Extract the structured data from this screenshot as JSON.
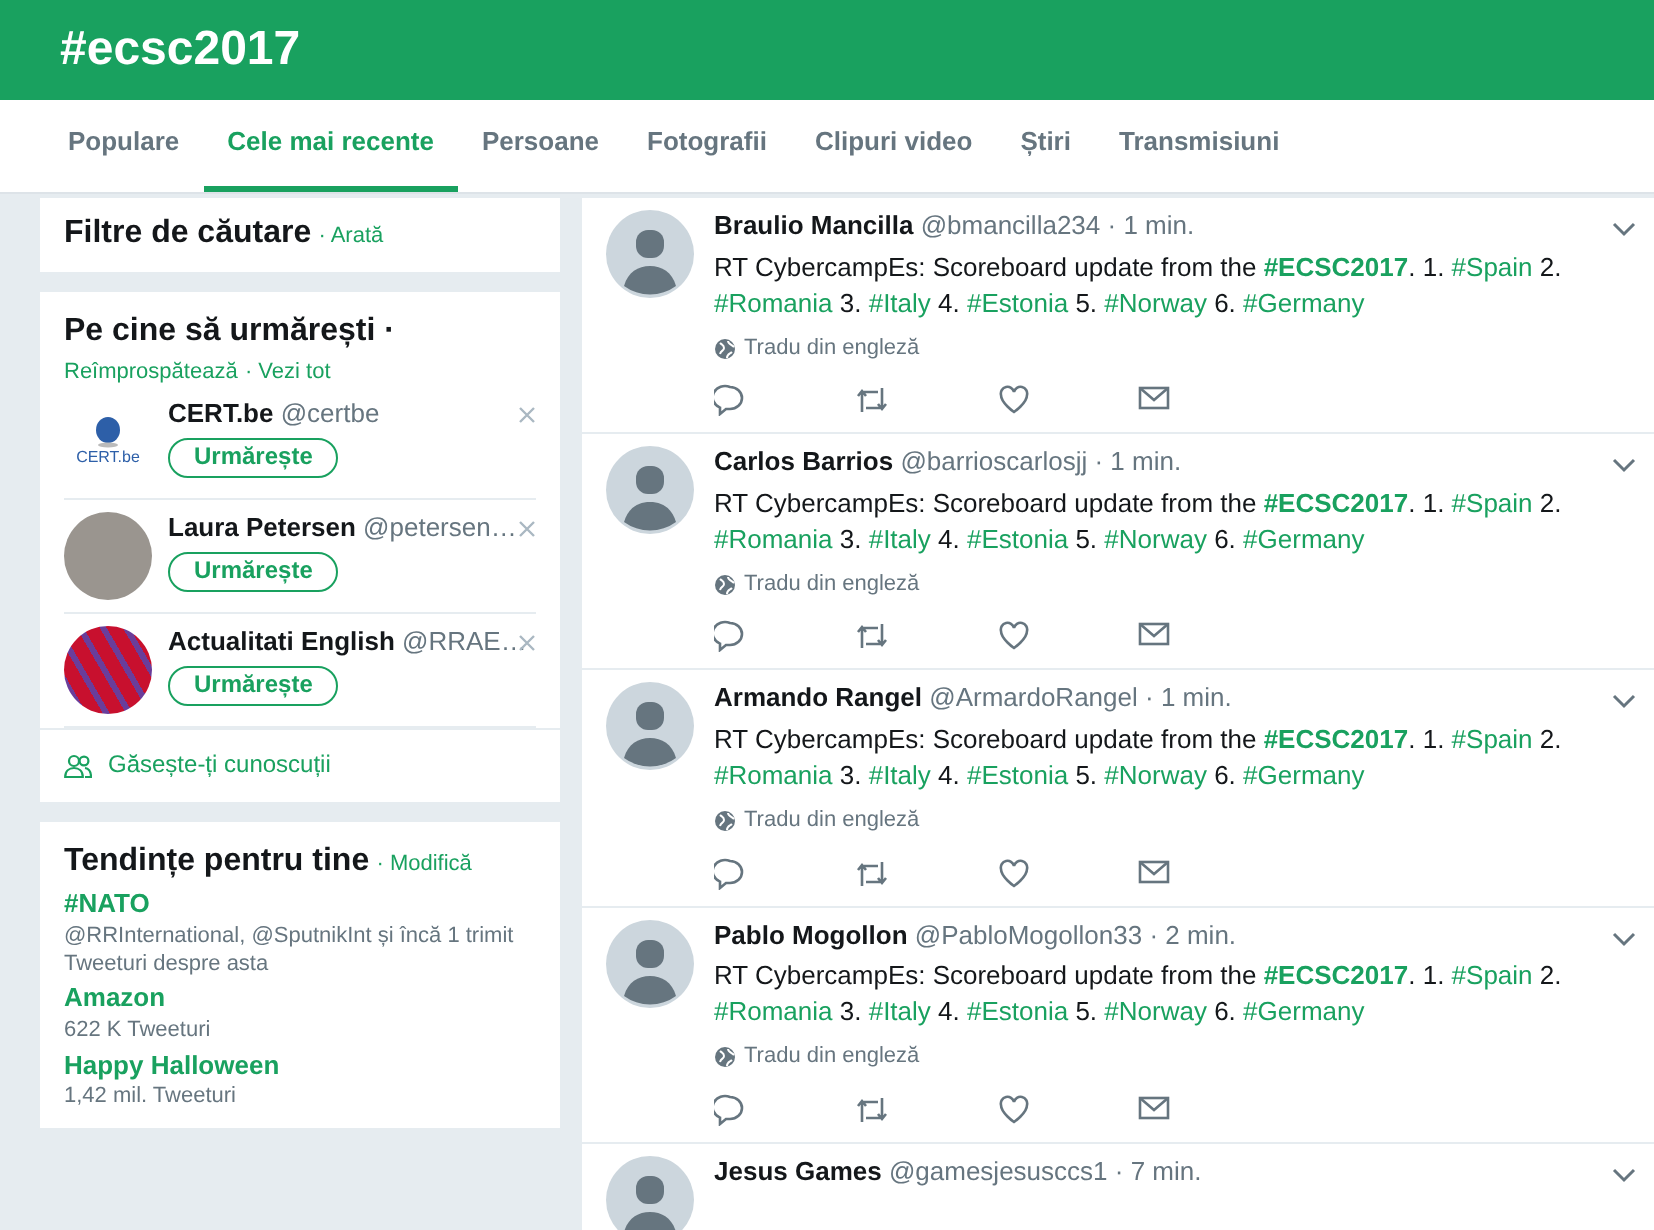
{
  "header": {
    "title": "#ecsc2017"
  },
  "tabs": [
    {
      "label": "Populare",
      "selected": false
    },
    {
      "label": "Cele mai recente",
      "selected": true
    },
    {
      "label": "Persoane",
      "selected": false
    },
    {
      "label": "Fotografii",
      "selected": false
    },
    {
      "label": "Clipuri video",
      "selected": false
    },
    {
      "label": "Știri",
      "selected": false
    },
    {
      "label": "Transmisiuni",
      "selected": false
    }
  ],
  "search_filters": {
    "title": "Filtre de căutare",
    "action": "· Arată"
  },
  "who_to_follow": {
    "title": "Pe cine să urmărești ·",
    "actions": [
      "Reîmprospătează",
      "· Vezi tot"
    ],
    "accounts": [
      {
        "name": "CERT.be",
        "handle": "@certbe",
        "kind": "logo",
        "logo_text": "CERT.be",
        "button": "Urmărește"
      },
      {
        "name": "Laura Petersen",
        "handle": "@petersen…",
        "kind": "photo",
        "button": "Urmărește"
      },
      {
        "name": "Actualitati English",
        "handle": "@RRAE…",
        "kind": "graphic",
        "button": "Urmărește"
      }
    ],
    "footer": "Găsește-ți cunoscuții"
  },
  "trends": {
    "title": "Tendințe pentru tine",
    "action": "· Modifică",
    "items": [
      {
        "name": "#NATO",
        "lines": [
          "@RRInternational, @SputnikInt și încă 1 trimit",
          "Tweeturi despre asta"
        ]
      },
      {
        "name": "Amazon",
        "lines": [
          "622 K Tweeturi"
        ]
      },
      {
        "name": "Happy Halloween",
        "lines": [
          "1,42 mil. Tweeturi"
        ]
      }
    ]
  },
  "tweets": [
    {
      "name": "Braulio Mancilla",
      "handle": "@bmancilla234",
      "time": "· 1 min.",
      "translate": "Tradu din engleză",
      "segments": [
        {
          "kind": "plain",
          "text": "RT CybercampEs: Scoreboard update from the "
        },
        {
          "kind": "hashtag_bold",
          "text": "#ECSC2017"
        },
        {
          "kind": "plain",
          "text": ". 1. "
        },
        {
          "kind": "hashtag",
          "text": "#Spain"
        },
        {
          "kind": "plain",
          "text": " 2. "
        },
        {
          "kind": "hashtag",
          "text": "#Romania"
        },
        {
          "kind": "plain",
          "text": " 3. "
        },
        {
          "kind": "hashtag",
          "text": "#Italy"
        },
        {
          "kind": "plain",
          "text": " 4. "
        },
        {
          "kind": "hashtag",
          "text": "#Estonia"
        },
        {
          "kind": "plain",
          "text": " 5. "
        },
        {
          "kind": "hashtag",
          "text": "#Norway"
        },
        {
          "kind": "plain",
          "text": " 6. "
        },
        {
          "kind": "hashtag",
          "text": "#Germany"
        }
      ]
    },
    {
      "name": "Carlos Barrios",
      "handle": "@barrioscarlosjj",
      "time": "· 1 min.",
      "translate": "Tradu din engleză",
      "segments": [
        {
          "kind": "plain",
          "text": "RT CybercampEs: Scoreboard update from the "
        },
        {
          "kind": "hashtag_bold",
          "text": "#ECSC2017"
        },
        {
          "kind": "plain",
          "text": ". 1. "
        },
        {
          "kind": "hashtag",
          "text": "#Spain"
        },
        {
          "kind": "plain",
          "text": " 2. "
        },
        {
          "kind": "hashtag",
          "text": "#Romania"
        },
        {
          "kind": "plain",
          "text": " 3. "
        },
        {
          "kind": "hashtag",
          "text": "#Italy"
        },
        {
          "kind": "plain",
          "text": " 4. "
        },
        {
          "kind": "hashtag",
          "text": "#Estonia"
        },
        {
          "kind": "plain",
          "text": " 5. "
        },
        {
          "kind": "hashtag",
          "text": "#Norway"
        },
        {
          "kind": "plain",
          "text": " 6. "
        },
        {
          "kind": "hashtag",
          "text": "#Germany"
        }
      ]
    },
    {
      "name": "Armando Rangel",
      "handle": "@ArmardoRangel",
      "time": "· 1 min.",
      "translate": "Tradu din engleză",
      "segments": [
        {
          "kind": "plain",
          "text": "RT CybercampEs: Scoreboard update from the "
        },
        {
          "kind": "hashtag_bold",
          "text": "#ECSC2017"
        },
        {
          "kind": "plain",
          "text": ". 1. "
        },
        {
          "kind": "hashtag",
          "text": "#Spain"
        },
        {
          "kind": "plain",
          "text": " 2. "
        },
        {
          "kind": "hashtag",
          "text": "#Romania"
        },
        {
          "kind": "plain",
          "text": " 3. "
        },
        {
          "kind": "hashtag",
          "text": "#Italy"
        },
        {
          "kind": "plain",
          "text": " 4. "
        },
        {
          "kind": "hashtag",
          "text": "#Estonia"
        },
        {
          "kind": "plain",
          "text": " 5. "
        },
        {
          "kind": "hashtag",
          "text": "#Norway"
        },
        {
          "kind": "plain",
          "text": " 6. "
        },
        {
          "kind": "hashtag",
          "text": "#Germany"
        }
      ]
    },
    {
      "name": "Pablo Mogollon",
      "handle": "@PabloMogollon33",
      "time": "· 2 min.",
      "translate": "Tradu din engleză",
      "segments": [
        {
          "kind": "plain",
          "text": "RT CybercampEs: Scoreboard update from the "
        },
        {
          "kind": "hashtag_bold",
          "text": "#ECSC2017"
        },
        {
          "kind": "plain",
          "text": ". 1. "
        },
        {
          "kind": "hashtag",
          "text": "#Spain"
        },
        {
          "kind": "plain",
          "text": " 2. "
        },
        {
          "kind": "hashtag",
          "text": "#Romania"
        },
        {
          "kind": "plain",
          "text": " 3. "
        },
        {
          "kind": "hashtag",
          "text": "#Italy"
        },
        {
          "kind": "plain",
          "text": " 4. "
        },
        {
          "kind": "hashtag",
          "text": "#Estonia"
        },
        {
          "kind": "plain",
          "text": " 5. "
        },
        {
          "kind": "hashtag",
          "text": "#Norway"
        },
        {
          "kind": "plain",
          "text": " 6. "
        },
        {
          "kind": "hashtag",
          "text": "#Germany"
        }
      ]
    },
    {
      "name": "Jesus Games",
      "handle": "@gamesjesusccs1",
      "time": "· 7 min."
    }
  ]
}
